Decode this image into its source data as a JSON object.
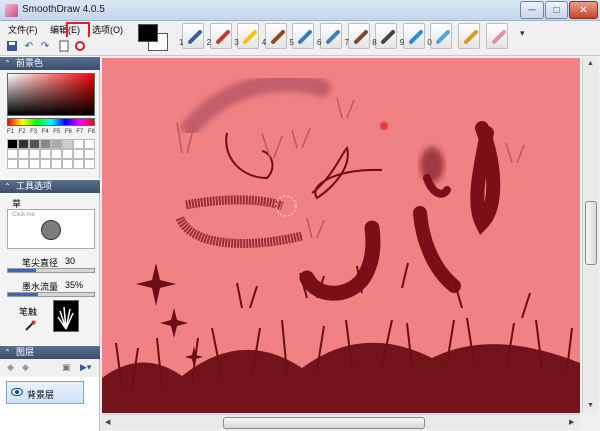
{
  "window": {
    "title": "SmoothDraw 4.0.5",
    "controls": {
      "minimize": "─",
      "maximize": "□",
      "close": "✕"
    }
  },
  "menu": {
    "items": [
      "文件(F)",
      "编辑(E)",
      "选项(O)"
    ]
  },
  "toolbar": {
    "icons": [
      "save-icon",
      "undo-icon",
      "redo-icon",
      "new-layer-icon",
      "fullscreen-icon"
    ]
  },
  "brushes": [
    {
      "num": "1",
      "color": "#3a5fa8"
    },
    {
      "num": "2",
      "color": "#c0392b"
    },
    {
      "num": "3",
      "color": "#f0c419"
    },
    {
      "num": "4",
      "color": "#8a4a22"
    },
    {
      "num": "5",
      "color": "#2f7fc1"
    },
    {
      "num": "6",
      "color": "#3b7fc6"
    },
    {
      "num": "7",
      "color": "#7a4a2a"
    },
    {
      "num": "8",
      "color": "#444444"
    },
    {
      "num": "9",
      "color": "#1f8fd6"
    },
    {
      "num": "0",
      "color": "#4fa3e0"
    },
    {
      "num": "",
      "color": "#d99a2b"
    },
    {
      "num": "",
      "color": "#e58fa0"
    }
  ],
  "panels": {
    "foreground": "前景色",
    "tool_options": "工具选项",
    "layers": "图层"
  },
  "palette_keys": [
    "F1",
    "F2",
    "F3",
    "F4",
    "F5",
    "F6",
    "F7",
    "F8"
  ],
  "palette_colors": [
    "#000000",
    "#333333",
    "#555555",
    "#888888",
    "#aaaaaa",
    "#cccccc",
    "#ffffff",
    "#ffffff"
  ],
  "tool": {
    "name": "草",
    "click_me": "Click me",
    "size_label": "笔尖直径",
    "size_value": "30",
    "size_level": 0.33,
    "flow_label": "墨水流量",
    "flow_value": "35%",
    "flow_level": 0.35,
    "tip_label": "笔触"
  },
  "layers": {
    "items": [
      {
        "name": "背景层"
      }
    ]
  },
  "canvas": {
    "background": "#f08283",
    "ink": "#7a0f18"
  }
}
